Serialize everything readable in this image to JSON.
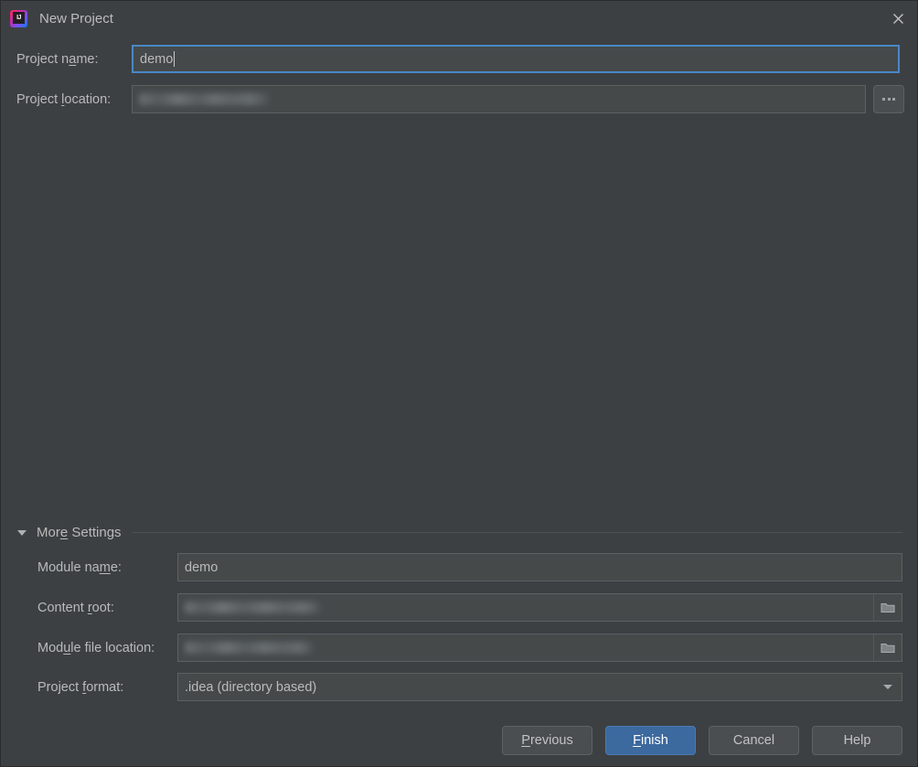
{
  "window": {
    "title": "New Project",
    "app_icon": "intellij-idea-icon",
    "close_icon": "close-icon",
    "background_color": "#3c4043",
    "accent_color": "#3c699e"
  },
  "form": {
    "project_name": {
      "label_before": "Project n",
      "label_mnemonic": "a",
      "label_after": "me:",
      "value": "demo",
      "focused": true
    },
    "project_location": {
      "label_before": "Project ",
      "label_mnemonic": "l",
      "label_after": "ocation:",
      "value": "",
      "redacted": true
    },
    "browse_button": {
      "label": "...",
      "icon": "ellipsis-icon"
    }
  },
  "more_settings": {
    "label_before": "Mor",
    "label_mnemonic": "e",
    "label_after": " Settings",
    "expanded": true,
    "expander_icon": "chevron-down-icon",
    "fields": {
      "module_name": {
        "label_before": "Module na",
        "label_mnemonic": "m",
        "label_after": "e:",
        "value": "demo"
      },
      "content_root": {
        "label_before": "Content ",
        "label_mnemonic": "r",
        "label_after": "oot:",
        "value": "",
        "redacted": true,
        "browse_icon": "folder-icon"
      },
      "module_file_location": {
        "label_before": "Mod",
        "label_mnemonic": "u",
        "label_after": "le file location:",
        "value": "",
        "redacted": true,
        "browse_icon": "folder-icon"
      },
      "project_format": {
        "label_before": "Project ",
        "label_mnemonic": "f",
        "label_after": "ormat:",
        "value": ".idea (directory based)",
        "dropdown_icon": "chevron-down-icon",
        "options": [
          ".idea (directory based)"
        ]
      }
    }
  },
  "footer": {
    "previous": {
      "before": "",
      "mnemonic": "P",
      "after": "revious"
    },
    "finish": {
      "before": "",
      "mnemonic": "F",
      "after": "inish",
      "primary": true
    },
    "cancel": {
      "before": "Cancel",
      "mnemonic": "",
      "after": ""
    },
    "help": {
      "before": "Help",
      "mnemonic": "",
      "after": ""
    }
  }
}
